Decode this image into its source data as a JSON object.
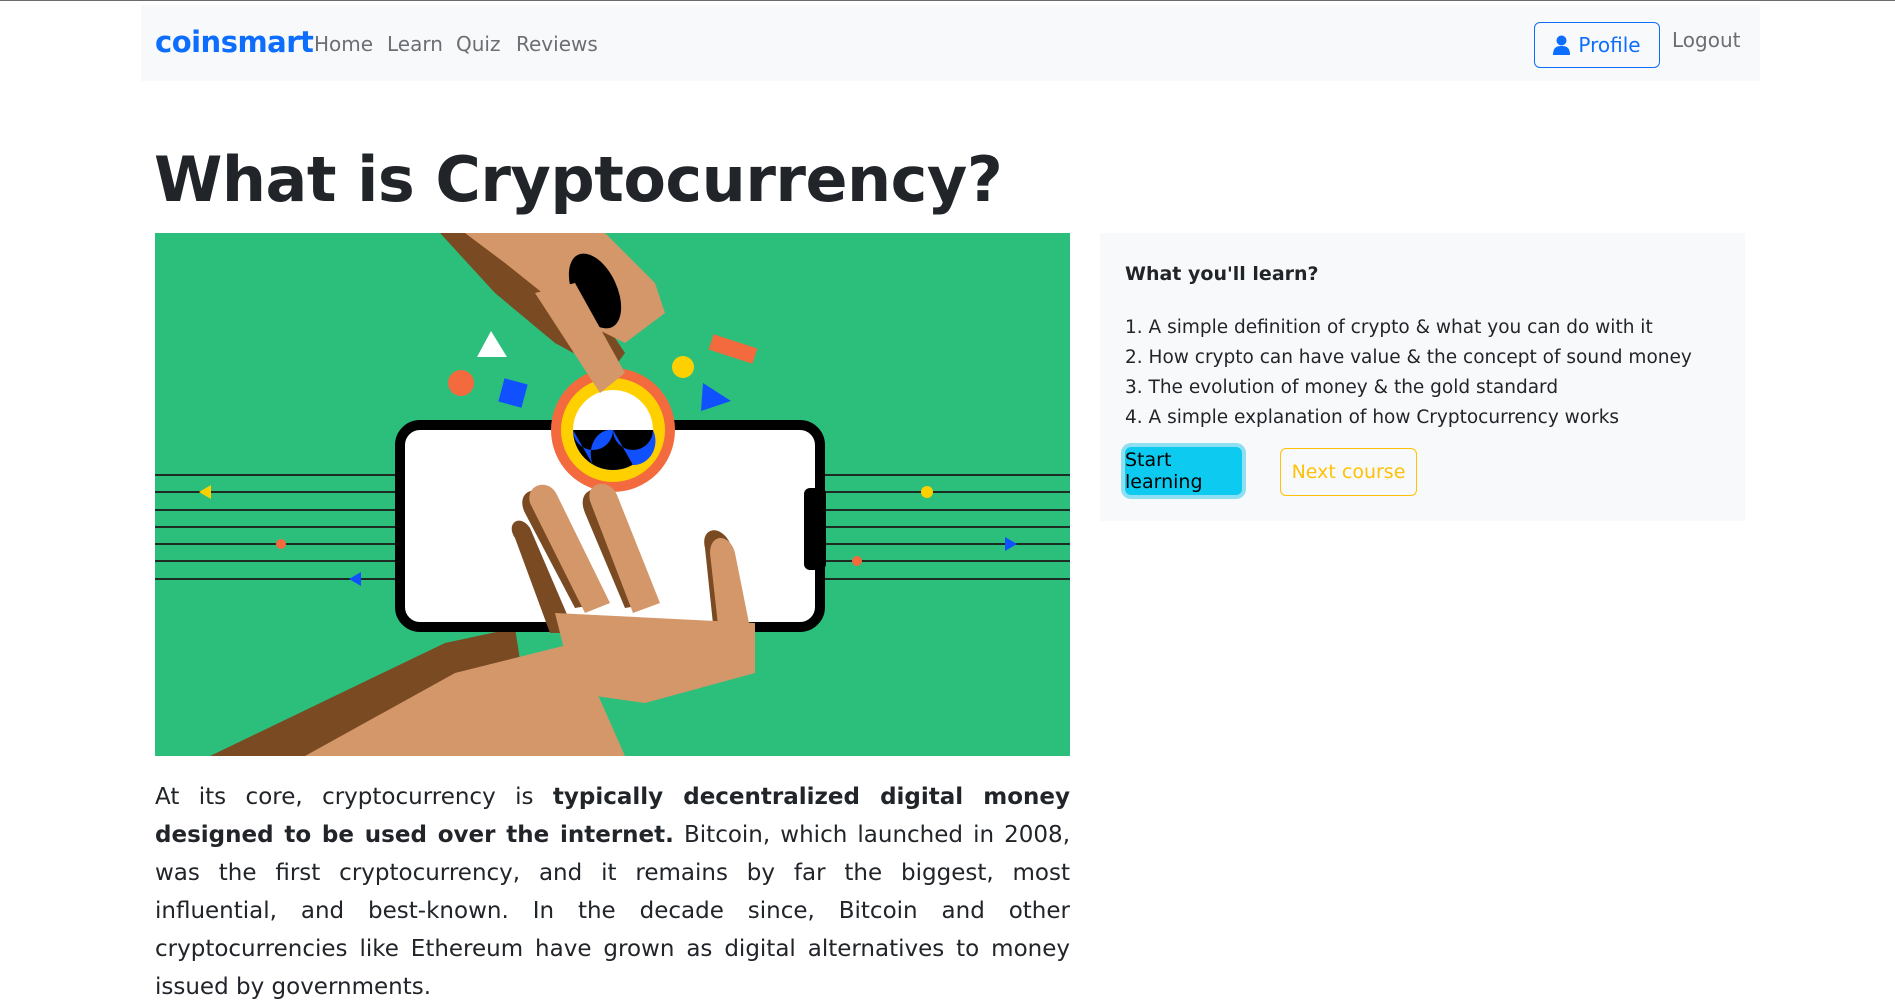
{
  "navbar": {
    "brand": "coinsmart",
    "links": [
      "Home",
      "Learn",
      "Quiz",
      "Reviews"
    ],
    "profile_label": "Profile",
    "logout_label": "Logout"
  },
  "page": {
    "title": "What is Cryptocurrency?"
  },
  "learn_card": {
    "title": "What you'll learn?",
    "items": [
      "1. A simple definition of crypto & what you can do with it",
      "2. How crypto can have value & the concept of sound money",
      "3. The evolution of money & the gold standard",
      "4. A simple explanation of how Cryptocurrency works"
    ],
    "start_label": "Start learning",
    "next_label": "Next course"
  },
  "article": {
    "intro": "At its core, cryptocurrency is ",
    "bold": "typically decentralized digital money designed to be used over the internet.",
    "rest": " Bitcoin, which launched in 2008, was the first cryptocurrency, and it remains by far the biggest, most influential, and best-known. In the decade since, Bitcoin and other cryptocurrencies like Ethereum have grown as digital alternatives to money issued by governments."
  },
  "colors": {
    "brand": "#0d6efd",
    "hero_bg": "#2cbf7c",
    "start_button": "#0dcaf0",
    "next_button": "#ffc107"
  },
  "icons": {
    "profile": "user-icon"
  }
}
